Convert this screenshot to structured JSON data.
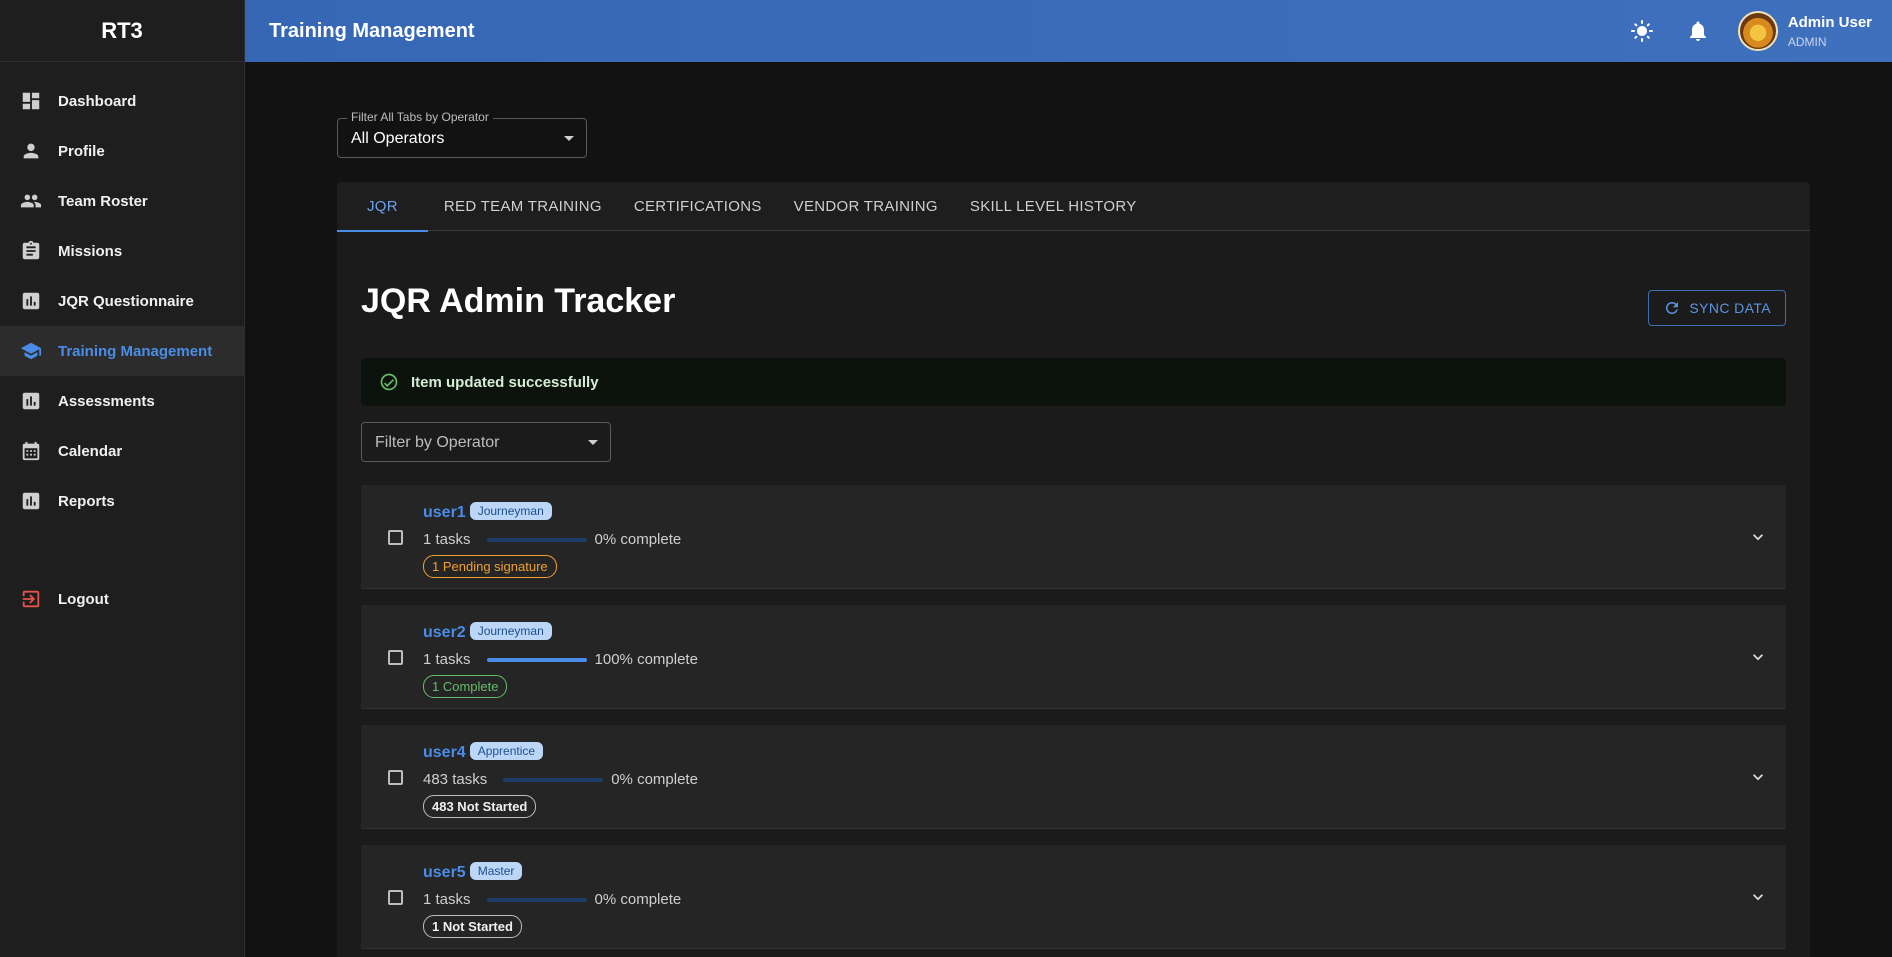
{
  "app": {
    "brand": "RT3"
  },
  "sidebar": {
    "items": [
      {
        "label": "Dashboard",
        "icon": "dashboard-icon"
      },
      {
        "label": "Profile",
        "icon": "person-icon"
      },
      {
        "label": "Team Roster",
        "icon": "people-icon"
      },
      {
        "label": "Missions",
        "icon": "clipboard-icon"
      },
      {
        "label": "JQR Questionnaire",
        "icon": "bar-chart-icon"
      },
      {
        "label": "Training Management",
        "icon": "school-icon",
        "active": true
      },
      {
        "label": "Assessments",
        "icon": "bar-chart-icon"
      },
      {
        "label": "Calendar",
        "icon": "calendar-icon"
      },
      {
        "label": "Reports",
        "icon": "bar-chart-icon"
      }
    ],
    "logout": "Logout"
  },
  "header": {
    "title": "Training Management",
    "user_name": "Admin User",
    "user_role": "ADMIN"
  },
  "filter_all": {
    "legend": "Filter All Tabs by Operator",
    "value": "All Operators"
  },
  "tabs": [
    {
      "label": "JQR",
      "active": true
    },
    {
      "label": "RED TEAM TRAINING"
    },
    {
      "label": "CERTIFICATIONS"
    },
    {
      "label": "VENDOR TRAINING"
    },
    {
      "label": "SKILL LEVEL HISTORY"
    }
  ],
  "tracker": {
    "title": "JQR Admin Tracker",
    "sync_label": "SYNC DATA",
    "alert": "Item updated successfully",
    "filter_placeholder": "Filter by Operator"
  },
  "users": [
    {
      "name": "user1",
      "rank": "Journeyman",
      "tasks": "1 tasks",
      "progress": 0,
      "progress_label": "0% complete",
      "status": "1 Pending signature",
      "status_type": "pending"
    },
    {
      "name": "user2",
      "rank": "Journeyman",
      "tasks": "1 tasks",
      "progress": 100,
      "progress_label": "100% complete",
      "status": "1 Complete",
      "status_type": "complete"
    },
    {
      "name": "user4",
      "rank": "Apprentice",
      "tasks": "483 tasks",
      "progress": 0,
      "progress_label": "0% complete",
      "status": "483 Not Started",
      "status_type": "notstarted"
    },
    {
      "name": "user5",
      "rank": "Master",
      "tasks": "1 tasks",
      "progress": 0,
      "progress_label": "0% complete",
      "status": "1 Not Started",
      "status_type": "notstarted"
    }
  ],
  "colors": {
    "accent": "#4a8de8",
    "header": "#3567b5",
    "pending": "#f0a033",
    "complete": "#66bb6a"
  }
}
